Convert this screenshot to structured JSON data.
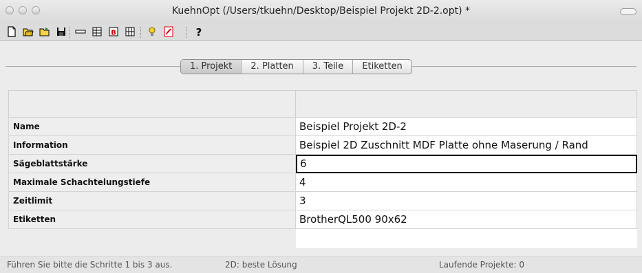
{
  "window": {
    "title": "KuehnOpt (/Users/tkuehn/Desktop/Beispiel Projekt 2D-2.opt) *"
  },
  "toolbar": {
    "icons": [
      "new-file-icon",
      "open-folder-icon",
      "open-recent-icon",
      "save-icon",
      "panel-horizontal-icon",
      "table-icon",
      "label-b-icon",
      "grid-view-icon",
      "lightbulb-icon",
      "pdf-icon",
      "help-icon"
    ]
  },
  "tabs": [
    {
      "label": "1. Projekt",
      "active": true
    },
    {
      "label": "2. Platten",
      "active": false
    },
    {
      "label": "3. Teile",
      "active": false
    },
    {
      "label": "Etiketten",
      "active": false
    }
  ],
  "project_table": {
    "rows": [
      {
        "label": "Name",
        "value": "Beispiel Projekt 2D-2"
      },
      {
        "label": "Information",
        "value": "Beispiel 2D Zuschnitt MDF Platte ohne Maserung / Rand"
      },
      {
        "label": "Sägeblattstärke",
        "value": "6"
      },
      {
        "label": "Maximale Schachtelungstiefe",
        "value": "4"
      },
      {
        "label": "Zeitlimit",
        "value": "3"
      },
      {
        "label": "Etiketten",
        "value": "BrotherQL500 90x62"
      }
    ]
  },
  "status": {
    "hint": "Führen Sie bitte die Schritte 1 bis 3 aus.",
    "mode": "2D: beste Lösung",
    "running": "Laufende Projekte: 0"
  }
}
